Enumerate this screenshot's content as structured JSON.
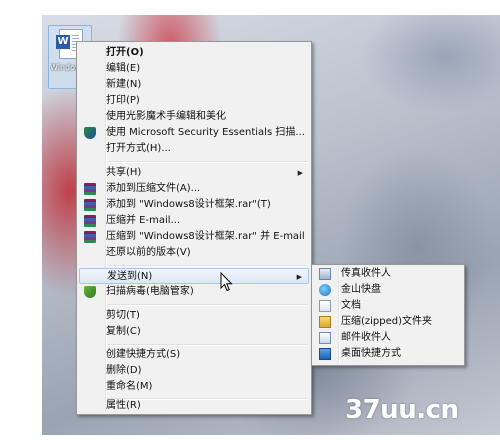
{
  "desktop": {
    "icon_label": "Windows8设计框架",
    "watermark": "37uu.cn"
  },
  "context_menu": {
    "items": [
      {
        "label": "打开(O)",
        "bold": true
      },
      {
        "label": "编辑(E)"
      },
      {
        "label": "新建(N)"
      },
      {
        "label": "打印(P)"
      },
      {
        "label": "使用光影魔术手编辑和美化"
      },
      {
        "label": "使用 Microsoft Security Essentials 扫描..."
      },
      {
        "label": "打开方式(H)..."
      },
      {
        "label": "共享(H)",
        "submenu": true
      },
      {
        "label": "添加到压缩文件(A)..."
      },
      {
        "label": "添加到 \"Windows8设计框架.rar\"(T)"
      },
      {
        "label": "压缩并 E-mail..."
      },
      {
        "label": "压缩到 \"Windows8设计框架.rar\" 并 E-mail"
      },
      {
        "label": "还原以前的版本(V)"
      },
      {
        "label": "发送到(N)",
        "submenu": true,
        "highlighted": true
      },
      {
        "label": "扫描病毒(电脑管家)"
      },
      {
        "label": "剪切(T)"
      },
      {
        "label": "复制(C)"
      },
      {
        "label": "创建快捷方式(S)"
      },
      {
        "label": "删除(D)"
      },
      {
        "label": "重命名(M)"
      },
      {
        "label": "属性(R)"
      }
    ]
  },
  "send_to_menu": {
    "items": [
      {
        "label": "传真收件人",
        "icon": "fax-icon"
      },
      {
        "label": "金山快盘",
        "icon": "kingsoft-icon"
      },
      {
        "label": "文档",
        "icon": "documents-icon"
      },
      {
        "label": "压缩(zipped)文件夹",
        "icon": "zip-folder-icon"
      },
      {
        "label": "邮件收件人",
        "icon": "mail-icon"
      },
      {
        "label": "桌面快捷方式",
        "icon": "desktop-icon"
      }
    ]
  },
  "glyphs": {
    "arrow": "▶"
  }
}
